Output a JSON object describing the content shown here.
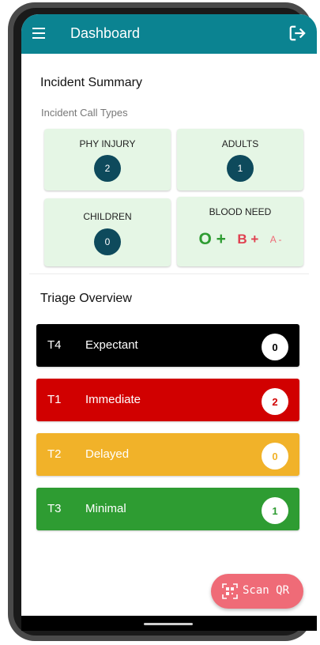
{
  "appbar": {
    "title": "Dashboard",
    "menu_icon": "menu-icon",
    "logout_icon": "logout-icon"
  },
  "incident": {
    "title": "Incident Summary",
    "subtitle": "Incident Call Types",
    "cards": {
      "phy_injury": {
        "label": "PHY INJURY",
        "count": "2"
      },
      "adults": {
        "label": "ADULTS",
        "count": "1"
      },
      "children": {
        "label": "CHILDREN",
        "count": "0"
      },
      "blood_need": {
        "label": "BLOOD NEED",
        "types": [
          {
            "text": "O +",
            "color": "#2e9c32"
          },
          {
            "text": "B +",
            "color": "#e04050"
          },
          {
            "text": "A -",
            "color": "#ef6b77"
          }
        ]
      }
    }
  },
  "triage": {
    "title": "Triage Overview",
    "items": [
      {
        "code": "T4",
        "name": "Expectant",
        "count": "0",
        "bg": "#000000",
        "count_color": "#000000"
      },
      {
        "code": "T1",
        "name": "Immediate",
        "count": "2",
        "bg": "#d10000",
        "count_color": "#d10000"
      },
      {
        "code": "T2",
        "name": "Delayed",
        "count": "0",
        "bg": "#f1b229",
        "count_color": "#f1b229"
      },
      {
        "code": "T3",
        "name": "Minimal",
        "count": "1",
        "bg": "#2e9c32",
        "count_color": "#2e9c32"
      }
    ]
  },
  "fab": {
    "label": "Scan QR",
    "icon": "qr-code-icon"
  }
}
